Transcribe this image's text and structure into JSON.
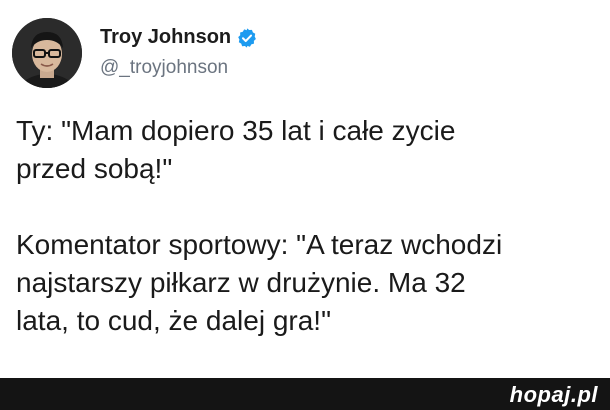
{
  "tweet": {
    "author": {
      "name": "Troy Johnson",
      "handle": "@_troyjohnson",
      "verified": true
    },
    "paragraphs": [
      "Ty: \"Mam dopiero 35 lat i całe zycie\nprzed sobą!\"",
      "Komentator sportowy: \"A teraz wchodzi\nnajstarszy piłkarz w drużynie. Ma 32\nlata, to cud, że dalej gra!\""
    ]
  },
  "footer": {
    "watermark": "hopaj.pl"
  },
  "colors": {
    "verified_badge": "#1d9bf0",
    "handle": "#6b7480",
    "footer_bg": "#141414"
  },
  "icons": {
    "verified": "verified-badge-icon",
    "avatar": "profile-photo"
  }
}
